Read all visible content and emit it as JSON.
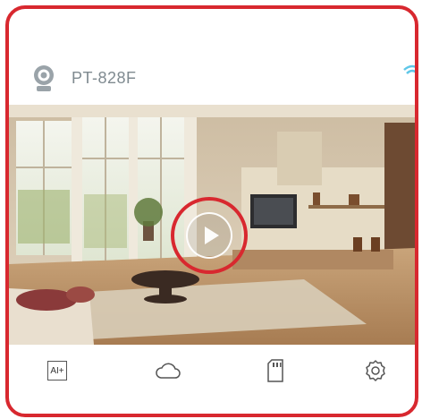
{
  "device": {
    "name": "PT-828F"
  },
  "toolbar": {
    "ai_label": "AI+",
    "items": [
      {
        "icon": "ai-plus-icon"
      },
      {
        "icon": "cloud-icon"
      },
      {
        "icon": "sd-card-icon"
      },
      {
        "icon": "settings-gear-icon"
      }
    ]
  },
  "colors": {
    "highlight_red": "#d8282f",
    "device_name_gray": "#7f8a90"
  }
}
